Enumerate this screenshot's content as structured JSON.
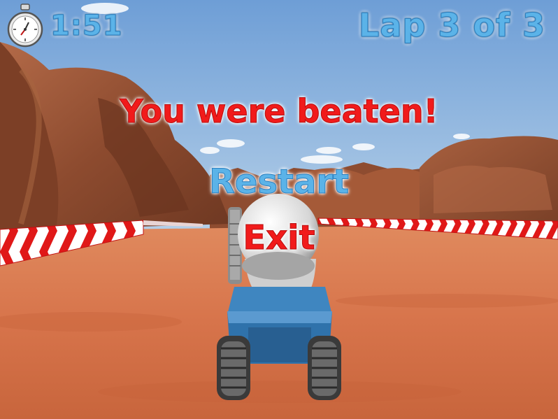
{
  "hud": {
    "timer_icon": "stopwatch-icon",
    "time": "1:51",
    "lap": "Lap 3 of 3"
  },
  "overlay": {
    "result": "You were beaten!",
    "restart_label": "Restart",
    "exit_label": "Exit"
  },
  "colors": {
    "sky": "#7ba6d8",
    "ground": "#d7754d",
    "rock": "#9a5638",
    "hud_blue": "#5bb3e8",
    "menu_red": "#f11b1b",
    "kart_blue": "#2f7bb5"
  }
}
